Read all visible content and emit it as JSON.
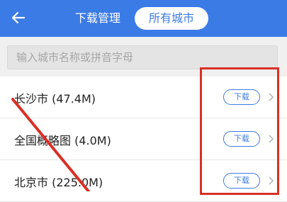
{
  "header": {
    "back_icon": "arrow-left-icon",
    "tabs": [
      {
        "label": "下载管理",
        "active": false
      },
      {
        "label": "所有城市",
        "active": true
      }
    ]
  },
  "search": {
    "placeholder": "输入城市名称或拼音字母"
  },
  "list": {
    "items": [
      {
        "name": "长沙市 (47.4M)",
        "action": "下载"
      },
      {
        "name": "全国概略图 (4.0M)",
        "action": "下载"
      },
      {
        "name": "北京市 (225.0M)",
        "action": "下载"
      }
    ]
  },
  "colors": {
    "header_bg": "#3b7be6",
    "accent": "#3b7be6",
    "annotation_red": "#d93025"
  }
}
